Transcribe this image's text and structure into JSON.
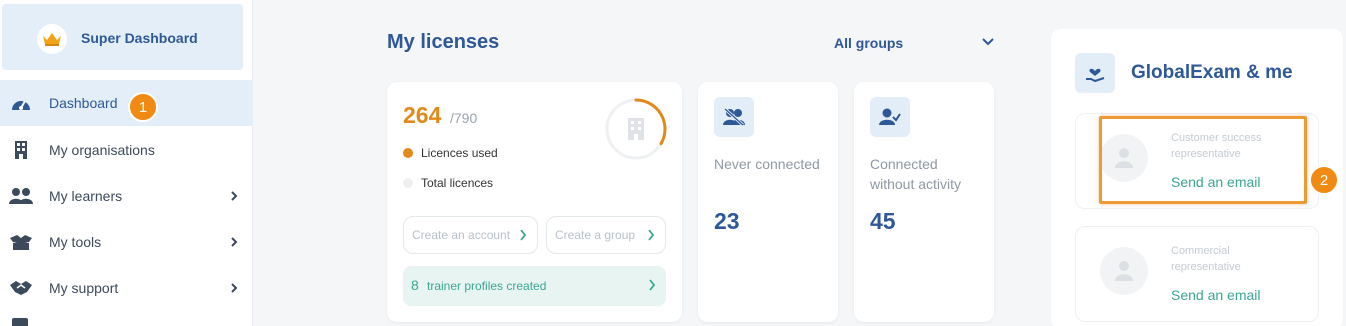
{
  "sidebar": {
    "super_dashboard": "Super Dashboard",
    "items": [
      {
        "label": "Dashboard",
        "icon": "gauge-icon"
      },
      {
        "label": "My organisations",
        "icon": "building-icon"
      },
      {
        "label": "My learners",
        "icon": "users-icon"
      },
      {
        "label": "My tools",
        "icon": "toolbox-icon"
      },
      {
        "label": "My support",
        "icon": "handshake-icon"
      }
    ]
  },
  "markers": {
    "one": "1",
    "two": "2"
  },
  "main": {
    "title": "My licenses",
    "group_filter": "All groups",
    "licenses": {
      "used": "264",
      "total": "/790",
      "legend_used": "Licences used",
      "legend_total": "Total licences",
      "create_account": "Create an account",
      "create_group": "Create a group",
      "trainer_count": "8",
      "trainer_label": "trainer profiles created"
    },
    "never_connected": {
      "label": "Never connected",
      "value": "23"
    },
    "no_activity": {
      "label_line1": "Connected",
      "label_line2": "without activity",
      "value": "45"
    }
  },
  "right_panel": {
    "title": "GlobalExam & me",
    "contacts": [
      {
        "role_line1": "Customer success",
        "role_line2": "representative",
        "action": "Send an email"
      },
      {
        "role_line1": "Commercial",
        "role_line2": "representative",
        "action": "Send an email"
      }
    ]
  },
  "colors": {
    "primary": "#2f5896",
    "accent": "#e18a1a",
    "teal": "#3aa694",
    "marker": "#f08a12"
  }
}
